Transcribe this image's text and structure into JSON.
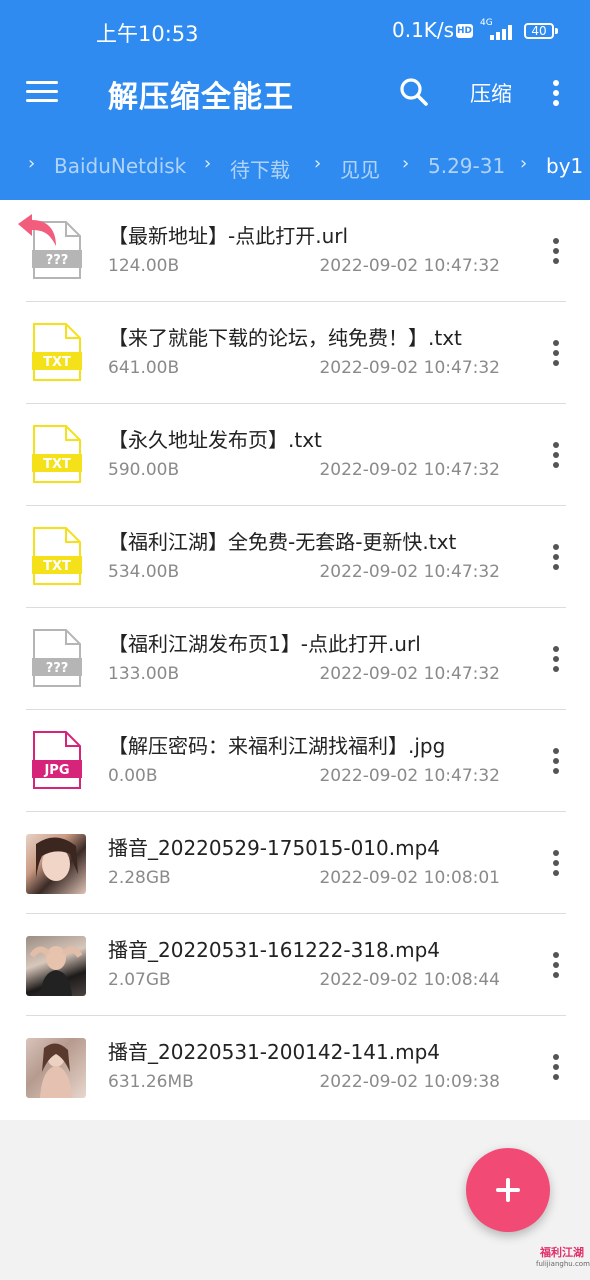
{
  "status_bar": {
    "time": "上午10:53",
    "speed": "0.1K/s",
    "hd": "HD",
    "network": "4G",
    "battery": "40"
  },
  "toolbar": {
    "menu_icon": "hamburger-menu-icon",
    "title": "解压缩全能王",
    "search_icon": "search-icon",
    "compress_label": "压缩",
    "more_icon": "more-vert-icon"
  },
  "breadcrumb": [
    "BaiduNetdisk",
    "待下载",
    "见见",
    "5.29-31",
    "by1"
  ],
  "files": [
    {
      "name": "【最新地址】-点此打开.url",
      "size": "124.00B",
      "date": "2022-09-02 10:47:32",
      "type": "unknown",
      "badge": "???",
      "shortcut": true
    },
    {
      "name": "【来了就能下载的论坛，纯免费！】.txt",
      "size": "641.00B",
      "date": "2022-09-02 10:47:32",
      "type": "txt",
      "badge": "TXT"
    },
    {
      "name": "【永久地址发布页】.txt",
      "size": "590.00B",
      "date": "2022-09-02 10:47:32",
      "type": "txt",
      "badge": "TXT"
    },
    {
      "name": "【福利江湖】全免费-无套路-更新快.txt",
      "size": "534.00B",
      "date": "2022-09-02 10:47:32",
      "type": "txt",
      "badge": "TXT"
    },
    {
      "name": "【福利江湖发布页1】-点此打开.url",
      "size": "133.00B",
      "date": "2022-09-02 10:47:32",
      "type": "unknown",
      "badge": "???"
    },
    {
      "name": "【解压密码：来福利江湖找福利】.jpg",
      "size": "0.00B",
      "date": "2022-09-02 10:47:32",
      "type": "jpg",
      "badge": "JPG"
    },
    {
      "name": "播音_20220529-175015-010.mp4",
      "size": "2.28GB",
      "date": "2022-09-02 10:08:01",
      "type": "video"
    },
    {
      "name": "播音_20220531-161222-318.mp4",
      "size": "2.07GB",
      "date": "2022-09-02 10:08:44",
      "type": "video"
    },
    {
      "name": "播音_20220531-200142-141.mp4",
      "size": "631.26MB",
      "date": "2022-09-02 10:09:38",
      "type": "video"
    }
  ],
  "fab": {
    "icon": "add-icon"
  },
  "watermark": {
    "text": "福利江湖",
    "url": "fulijianghu.com"
  },
  "colors": {
    "primary": "#2f8bf0",
    "txt_badge": "#f4e11a",
    "jpg_badge": "#d6247a",
    "unknown_badge": "#b5b5b5",
    "fab": "#f04a75",
    "shortcut_arrow": "#f25d7e"
  }
}
